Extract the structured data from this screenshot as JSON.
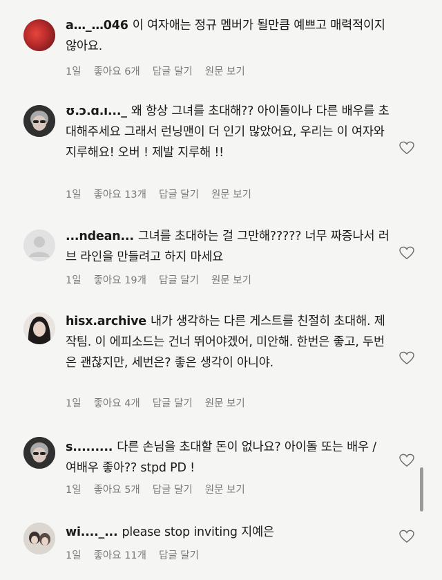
{
  "comments": [
    {
      "username": "a…_…046",
      "text": "이 여자애는 정규 멤버가 될만큼 예쁘고 매력적이지 않아요.",
      "time": "1일",
      "likes": "좋아요 6개",
      "reply": "답글 달기",
      "see_original": "원문 보기"
    },
    {
      "username": "ʊ.ɔ.ɑ.ı..._",
      "text": "왜 항상 그녀를 초대해?? 아이돌이나 다른 배우를 초대해주세요 그래서 런닝맨이 더 인기 많았어요, 우리는 이 여자와 지루해요! 오버 ! 제발 지루해 !!",
      "time": "1일",
      "likes": "좋아요 13개",
      "reply": "답글 달기",
      "see_original": "원문 보기"
    },
    {
      "username": "...ndean...",
      "text": "그녀를 초대하는 걸 그만해????? 너무 짜증나서 러브 라인을 만들려고 하지 마세요",
      "time": "1일",
      "likes": "좋아요 19개",
      "reply": "답글 달기",
      "see_original": "원문 보기"
    },
    {
      "username": "hisx.archive",
      "text": "내가 생각하는 다른 게스트를 친절히 초대해. 제작팀. 이 에피소드는 건너 뛰어야겠어, 미안해. 한번은 좋고, 두번은 괜찮지만, 세번은? 좋은 생각이 아니야.",
      "time": "1일",
      "likes": "좋아요 4개",
      "reply": "답글 달기",
      "see_original": "원문 보기"
    },
    {
      "username": "s.........",
      "text": "다른 손님을 초대할 돈이 없나요? 아이돌 또는 배우 / 여배우 좋아?? stpd PD !",
      "time": "1일",
      "likes": "좋아요 5개",
      "reply": "답글 달기",
      "see_original": "원문 보기"
    },
    {
      "username": "wi...._...",
      "text": "please stop inviting 지예은",
      "time": "1일",
      "likes": "좋아요 11개",
      "reply": "답글 달기",
      "see_original": ""
    }
  ],
  "colors": {
    "background": "#f5f5f4",
    "meta_text": "#7a7a7a",
    "body_text": "#1a1a1a"
  },
  "icons": {
    "like": "heart-outline-icon",
    "avatar_default": "default-profile-icon"
  }
}
